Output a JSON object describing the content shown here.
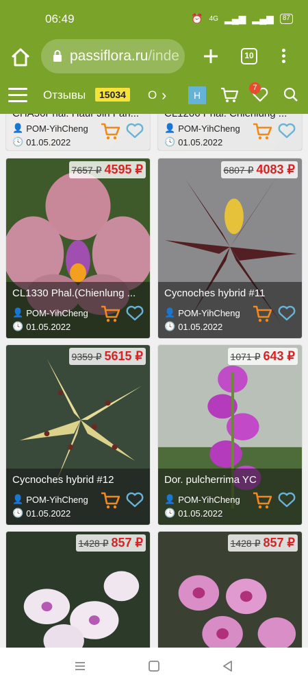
{
  "status": {
    "time": "06:49",
    "network": "4G",
    "battery": "87"
  },
  "browser": {
    "url_host": "passiflora.ru",
    "url_path": "/inde",
    "tab_count": "10"
  },
  "nav": {
    "reviews_label": "Отзывы",
    "reviews_count": "15034",
    "next_label": "О",
    "h_label": "Н",
    "fav_count": "7"
  },
  "colors": {
    "brand_green": "#7aa32a",
    "price_red": "#e02020",
    "cart_orange": "#f08a1c",
    "heart_blue": "#6ab2d6"
  },
  "products": [
    {
      "name": "CHA56Phal. Haur Jih Fan...",
      "seller": "POM-YihCheng",
      "date": "01.05.2022",
      "price_old": "",
      "price_new": ""
    },
    {
      "name": "CL1206 Phal. Chienlung ...",
      "seller": "POM-YihCheng",
      "date": "01.05.2022",
      "price_old": "",
      "price_new": ""
    },
    {
      "name": "CL1330 Phal.(Chienlung ...",
      "seller": "POM-YihCheng",
      "date": "01.05.2022",
      "price_old": "7657 ₽",
      "price_new": "4595 ₽"
    },
    {
      "name": "Cycnoches hybrid #11",
      "seller": "POM-YihCheng",
      "date": "01.05.2022",
      "price_old": "6807 ₽",
      "price_new": "4083 ₽"
    },
    {
      "name": "Cycnoches hybrid #12",
      "seller": "POM-YihCheng",
      "date": "01.05.2022",
      "price_old": "9359 ₽",
      "price_new": "5615 ₽"
    },
    {
      "name": "Dor. pulcherrima YC",
      "seller": "POM-YihCheng",
      "date": "01.05.2022",
      "price_old": "1071 ₽",
      "price_new": "643 ₽"
    },
    {
      "name": "",
      "seller": "",
      "date": "",
      "price_old": "1428 ₽",
      "price_new": "857 ₽"
    },
    {
      "name": "",
      "seller": "",
      "date": "",
      "price_old": "1428 ₽",
      "price_new": "857 ₽"
    }
  ]
}
